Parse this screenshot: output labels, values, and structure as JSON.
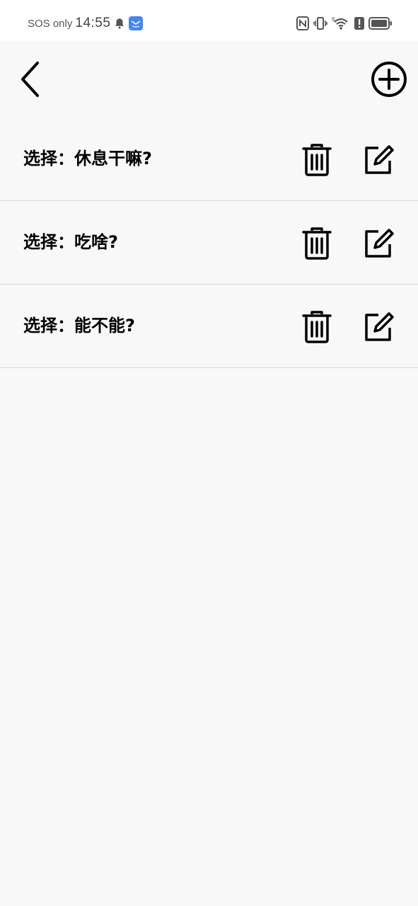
{
  "status_bar": {
    "carrier": "SOS only",
    "time": "14:55",
    "icons": [
      "bell-icon",
      "app-notification-icon",
      "nfc-icon",
      "vibrate-icon",
      "wifi-icon",
      "alert-icon",
      "battery-icon"
    ],
    "wifi_badge": "6"
  },
  "app_bar": {
    "back_icon": "chevron-left-icon",
    "add_icon": "plus-circle-icon"
  },
  "items": [
    {
      "label": "选择：休息干嘛?",
      "delete_icon": "trash-icon",
      "edit_icon": "edit-icon"
    },
    {
      "label": "选择：吃啥?",
      "delete_icon": "trash-icon",
      "edit_icon": "edit-icon"
    },
    {
      "label": "选择：能不能?",
      "delete_icon": "trash-icon",
      "edit_icon": "edit-icon"
    }
  ],
  "colors": {
    "background": "#f8f8f8",
    "status_bar_bg": "#ffffff",
    "divider": "#d8d8d8",
    "icon": "#000000",
    "app_notification": "#4a86e8"
  }
}
